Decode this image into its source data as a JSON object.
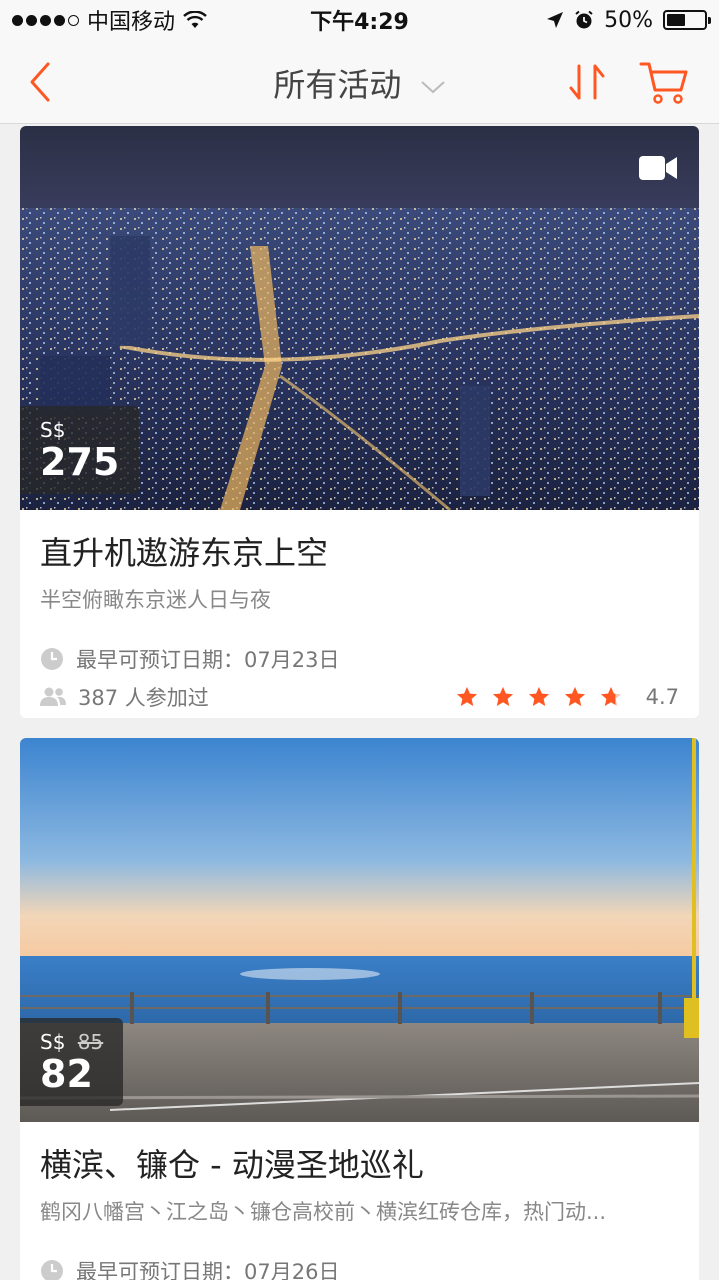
{
  "status_bar": {
    "carrier": "中国移动",
    "time": "下午4:29",
    "battery": "50%",
    "battery_level": 0.5
  },
  "nav": {
    "title": "所有活动",
    "icons": [
      "chevron-left-icon",
      "chevron-down-icon",
      "sort-icon",
      "cart-icon"
    ]
  },
  "colors": {
    "accent": "#ff5722",
    "star": "#ff5722",
    "background": "#f0f0f0"
  },
  "activities": [
    {
      "price_currency": "S$",
      "price": "275",
      "title": "直升机遨游东京上空",
      "subtitle": "半空俯瞰东京迷人日与夜",
      "booking_date_label": "最早可预订日期：07月23日",
      "participants": "387 人参加过",
      "rating": "4.7",
      "rating_value": 4.7,
      "has_video": true
    },
    {
      "price_currency": "S$",
      "original_price": "85",
      "price": "82",
      "title": "横滨、镰仓 - 动漫圣地巡礼",
      "subtitle": "鹤冈八幡宫丶江之岛丶镰仓高校前丶横滨红砖仓库，热门动...",
      "booking_date_label": "最早可预订日期：07月26日"
    }
  ]
}
